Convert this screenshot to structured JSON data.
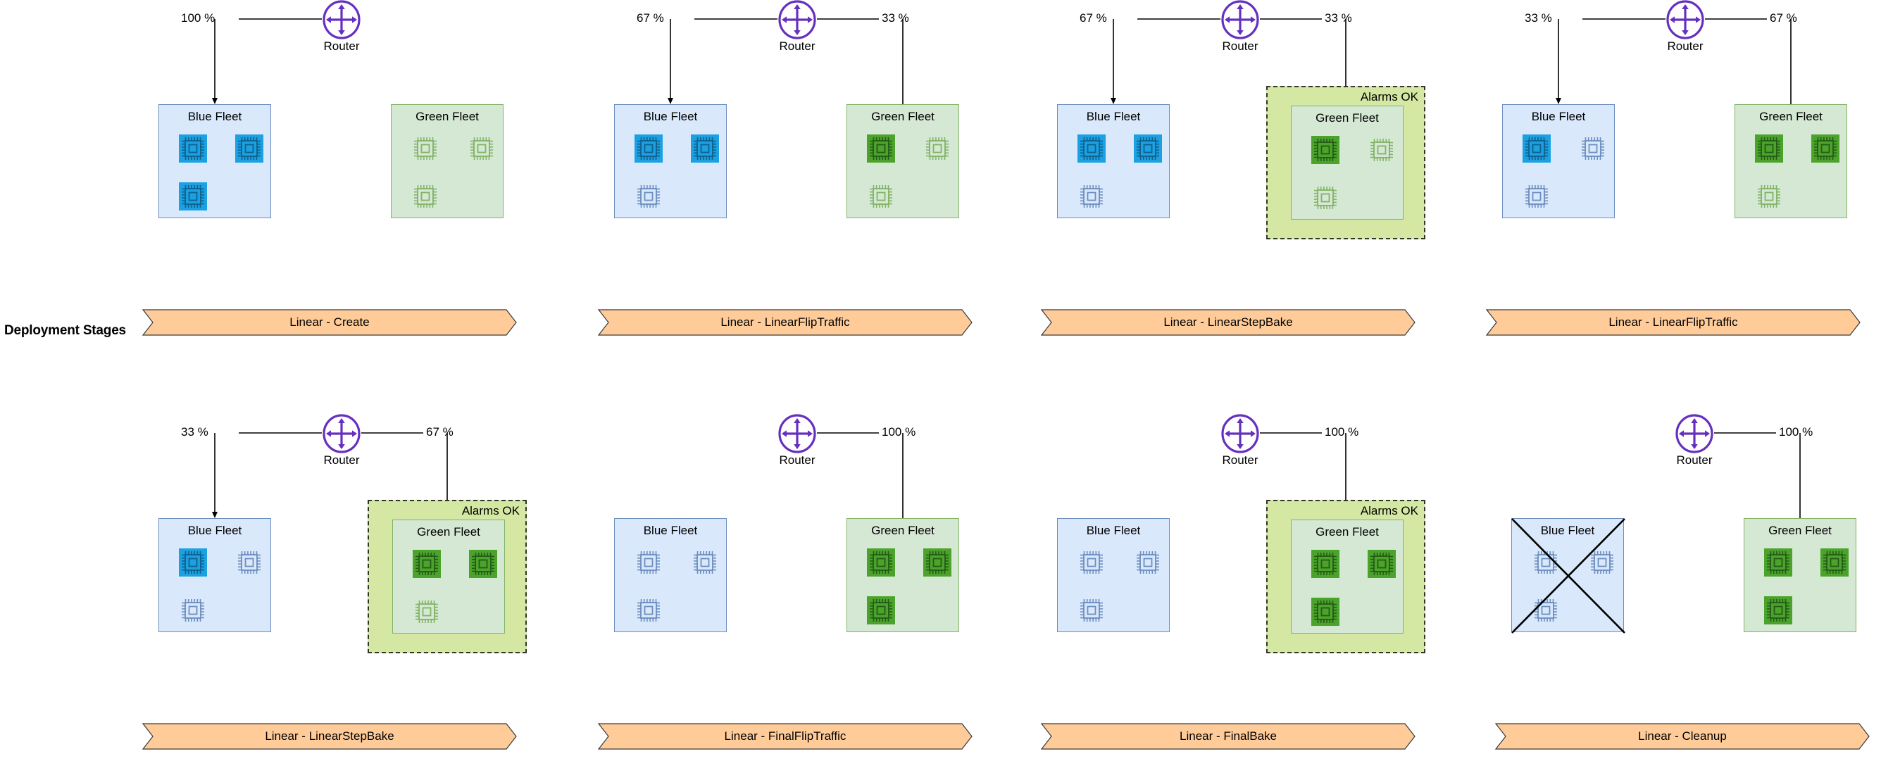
{
  "diagram": {
    "side_label": "Deployment Stages",
    "router_label": "Router",
    "blue_fleet_label": "Blue Fleet",
    "green_fleet_label": "Green Fleet",
    "alarms_label": "Alarms OK",
    "colors": {
      "router_stroke": "#6630bf",
      "blue_fleet_fill": "#dae8fc",
      "blue_fleet_border": "#6c8ebf",
      "blue_chip_active": "#1ba1e2",
      "blue_chip_inactive_stroke": "#6c8ebf",
      "green_fleet_fill": "#d5e8d4",
      "green_fleet_border": "#82b366",
      "green_chip_active": "#4ca32b",
      "green_chip_inactive_stroke": "#82b366",
      "alarms_fill": "#d5e8a3",
      "alarms_border": "#333333",
      "stage_fill": "#ffcc99",
      "stage_border": "#36393d",
      "connector": "#000000"
    },
    "panels": [
      {
        "id": "panel-1",
        "stage": "Linear - Create",
        "blue_pct": "100 %",
        "green_pct": "",
        "blue_chips": [
          true,
          true,
          true
        ],
        "green_chips": [
          false,
          false,
          false
        ],
        "alarms_on_green": false,
        "blue_crossed_out": false,
        "arrow_to": "blue"
      },
      {
        "id": "panel-2",
        "stage": "Linear - LinearFlipTraffic",
        "blue_pct": "67 %",
        "green_pct": "33 %",
        "blue_chips": [
          true,
          true,
          false
        ],
        "green_chips": [
          true,
          false,
          false
        ],
        "alarms_on_green": false,
        "blue_crossed_out": false,
        "arrow_to": "both"
      },
      {
        "id": "panel-3",
        "stage": "Linear - LinearStepBake",
        "blue_pct": "67 %",
        "green_pct": "33 %",
        "blue_chips": [
          true,
          true,
          false
        ],
        "green_chips": [
          true,
          false,
          false
        ],
        "alarms_on_green": true,
        "blue_crossed_out": false,
        "arrow_to": "both"
      },
      {
        "id": "panel-4",
        "stage": "Linear - LinearFlipTraffic",
        "blue_pct": "33 %",
        "green_pct": "67 %",
        "blue_chips": [
          true,
          false,
          false
        ],
        "green_chips": [
          true,
          true,
          false
        ],
        "alarms_on_green": false,
        "blue_crossed_out": false,
        "arrow_to": "both"
      },
      {
        "id": "panel-5",
        "stage": "Linear - LinearStepBake",
        "blue_pct": "33 %",
        "green_pct": "67 %",
        "blue_chips": [
          true,
          false,
          false
        ],
        "green_chips": [
          true,
          true,
          false
        ],
        "alarms_on_green": true,
        "blue_crossed_out": false,
        "arrow_to": "both"
      },
      {
        "id": "panel-6",
        "stage": "Linear - FinalFlipTraffic",
        "blue_pct": "",
        "green_pct": "100 %",
        "blue_chips": [
          false,
          false,
          false
        ],
        "green_chips": [
          true,
          true,
          true
        ],
        "alarms_on_green": false,
        "blue_crossed_out": false,
        "arrow_to": "green"
      },
      {
        "id": "panel-7",
        "stage": "Linear - FinalBake",
        "blue_pct": "",
        "green_pct": "100 %",
        "blue_chips": [
          false,
          false,
          false
        ],
        "green_chips": [
          true,
          true,
          true
        ],
        "alarms_on_green": true,
        "blue_crossed_out": false,
        "arrow_to": "green"
      },
      {
        "id": "panel-8",
        "stage": "Linear - Cleanup",
        "blue_pct": "",
        "green_pct": "100 %",
        "blue_chips": [
          false,
          false,
          false
        ],
        "green_chips": [
          true,
          true,
          true
        ],
        "alarms_on_green": false,
        "blue_crossed_out": true,
        "arrow_to": "green"
      }
    ]
  }
}
